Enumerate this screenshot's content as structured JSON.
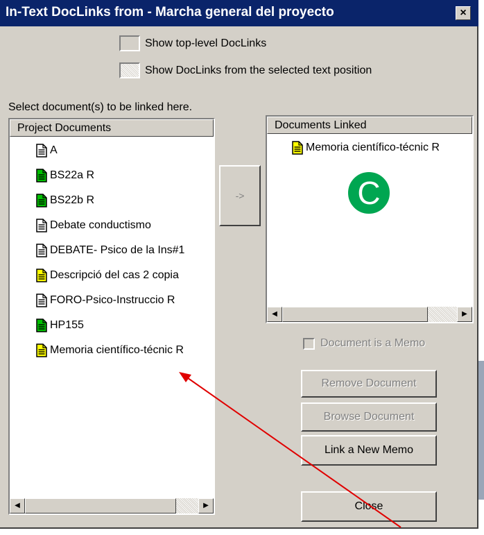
{
  "window": {
    "title": "In-Text DocLinks from - Marcha general del proyecto",
    "close_glyph": "×"
  },
  "options": {
    "show_top_level": "Show top-level DocLinks",
    "show_from_selected": "Show DocLinks from the selected text position"
  },
  "instruction": "Select document(s) to be linked here.",
  "project_documents": {
    "header": "Project Documents",
    "items": [
      {
        "label": "A",
        "icon": "document-icon",
        "color": "#ffffff"
      },
      {
        "label": "BS22a R",
        "icon": "document-icon",
        "color": "#00c000"
      },
      {
        "label": "BS22b R",
        "icon": "document-icon",
        "color": "#00c000"
      },
      {
        "label": "Debate conductismo",
        "icon": "document-icon",
        "color": "#ffffff"
      },
      {
        "label": "DEBATE- Psico de la Ins#1",
        "icon": "document-icon",
        "color": "#ffffff"
      },
      {
        "label": "Descripció del cas 2 copia",
        "icon": "memo-icon",
        "color": "#ffff00"
      },
      {
        "label": "FORO-Psico-Instruccio R",
        "icon": "document-icon",
        "color": "#ffffff"
      },
      {
        "label": "HP155",
        "icon": "document-icon",
        "color": "#00c000"
      },
      {
        "label": "Memoria científico-técnic R",
        "icon": "memo-icon",
        "color": "#ffff00"
      }
    ]
  },
  "documents_linked": {
    "header": "Documents Linked",
    "items": [
      {
        "label": "Memoria científico-técnic R",
        "icon": "memo-icon",
        "color": "#ffff00"
      }
    ]
  },
  "link_button": "->",
  "annotation": {
    "letter": "C",
    "color": "#00a651"
  },
  "memo_checkbox": "Document is a Memo",
  "buttons": {
    "remove": "Remove Document",
    "browse": "Browse Document",
    "link_memo": "Link a New Memo",
    "close": "Close"
  },
  "colors": {
    "titlebar": "#0a246a",
    "dialog": "#d4d0c8",
    "arrow": "#e00000"
  }
}
